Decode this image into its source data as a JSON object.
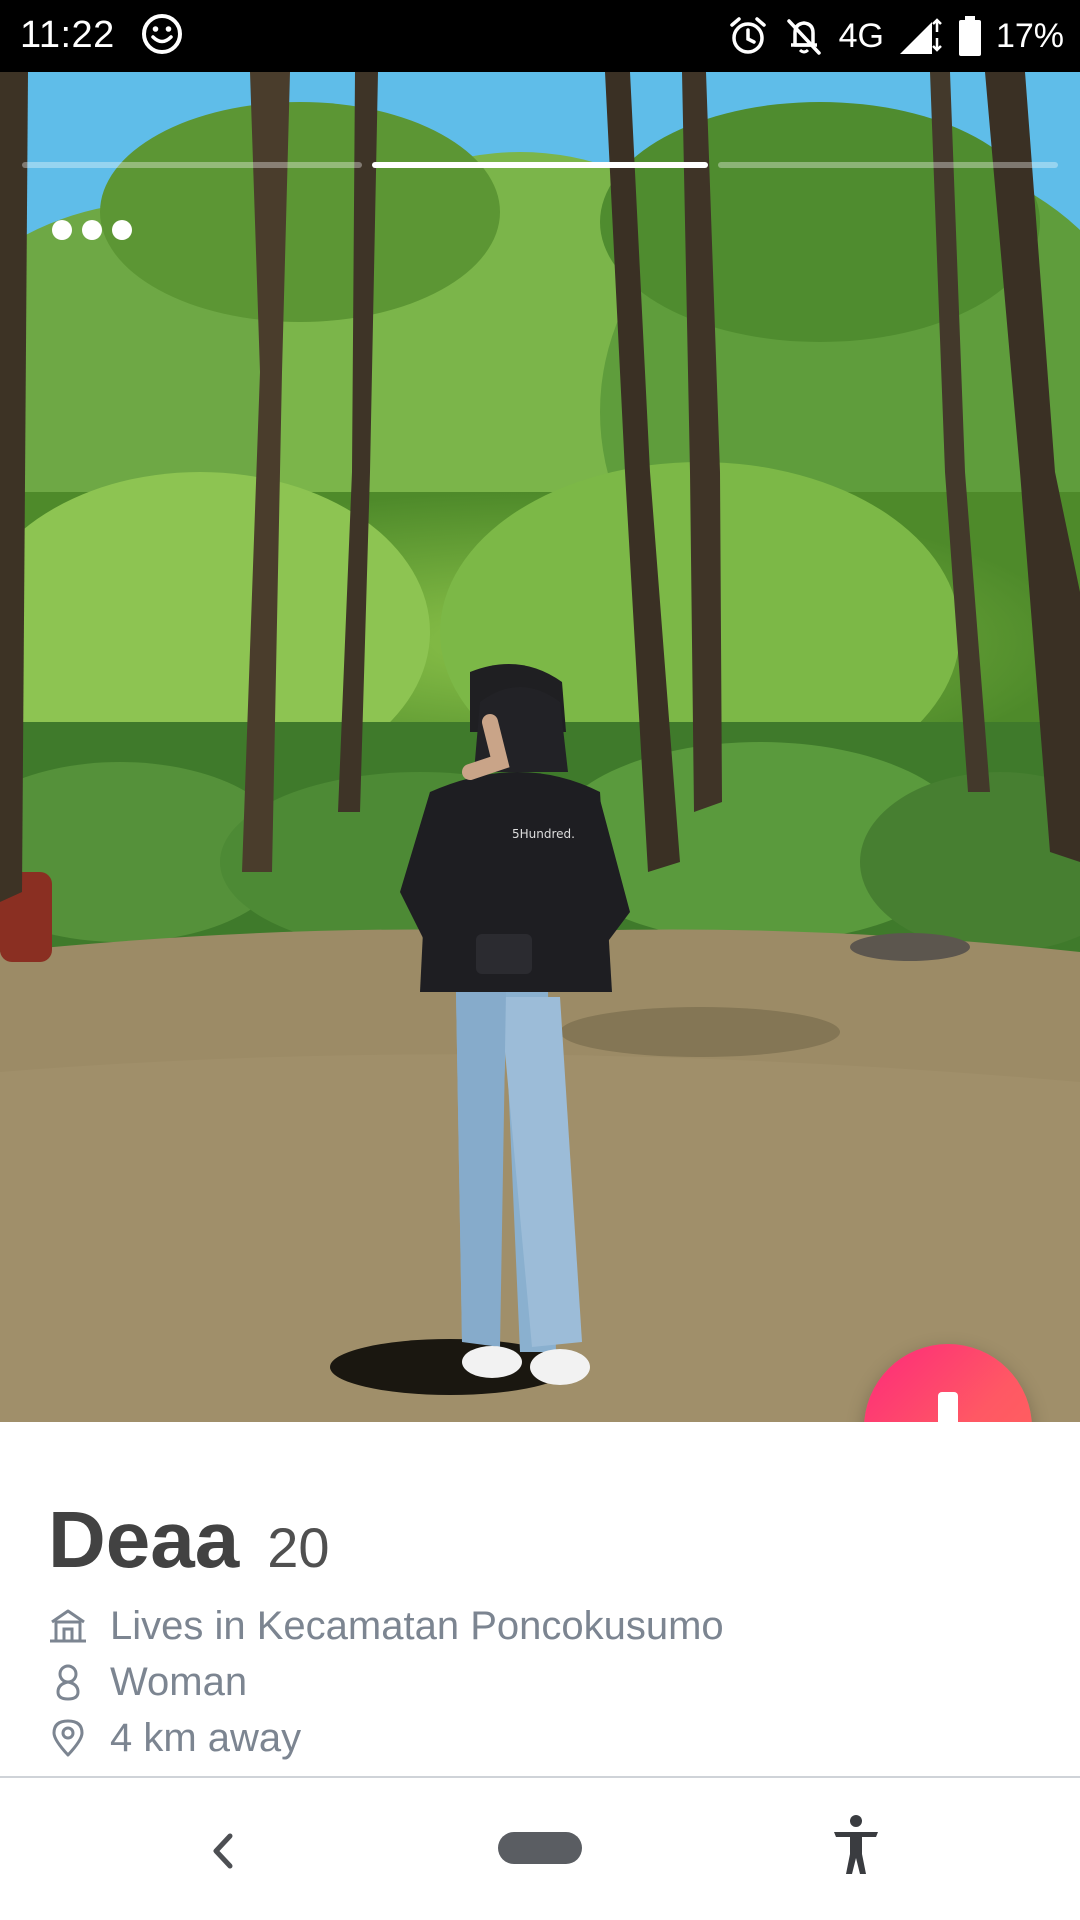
{
  "status_bar": {
    "time": "11:22",
    "network": "4G",
    "battery": "17%",
    "icons": [
      "smiley-icon",
      "alarm-icon",
      "notifications-off-icon",
      "signal-icon",
      "battery-icon"
    ]
  },
  "photo": {
    "progress": {
      "segments": 3,
      "active_index": 1
    },
    "more_icon": "more-dots-icon",
    "shirt_text": "5Hundred."
  },
  "profile": {
    "name": "Deaa",
    "age": "20",
    "details": [
      {
        "icon": "home-icon",
        "text": "Lives in Kecamatan Poncokusumo"
      },
      {
        "icon": "person-icon",
        "text": "Woman"
      },
      {
        "icon": "location-pin-icon",
        "text": "4 km away"
      }
    ]
  },
  "collapse_button": {
    "icon": "arrow-down-icon",
    "colors": [
      "#fd297b",
      "#ff655b"
    ]
  },
  "nav_bar": {
    "icons": [
      "back-icon",
      "home-pill-icon",
      "accessibility-icon"
    ]
  }
}
